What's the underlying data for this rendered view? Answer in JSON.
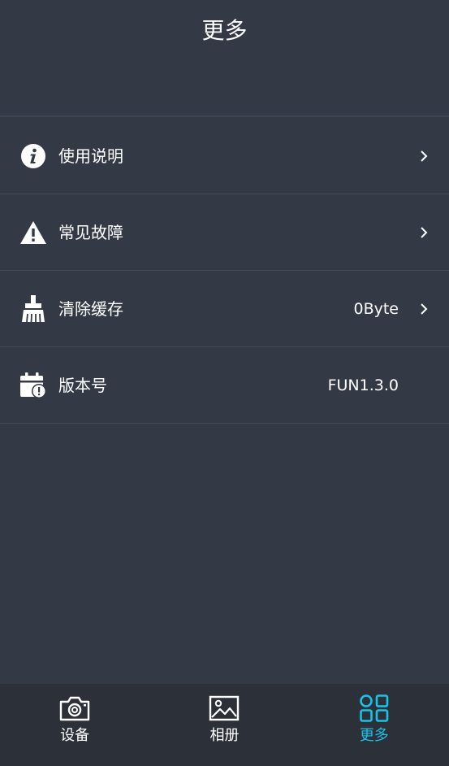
{
  "header": {
    "title": "更多"
  },
  "menu": {
    "items": [
      {
        "label": "使用说明",
        "value": "",
        "icon": "info-icon",
        "has_chevron": true
      },
      {
        "label": "常见故障",
        "value": "",
        "icon": "warning-icon",
        "has_chevron": true
      },
      {
        "label": "清除缓存",
        "value": "0Byte",
        "icon": "broom-icon",
        "has_chevron": true
      },
      {
        "label": "版本号",
        "value": "FUN1.3.0",
        "icon": "calendar-alert-icon",
        "has_chevron": false
      }
    ]
  },
  "tabbar": {
    "tabs": [
      {
        "label": "设备",
        "icon": "camera-icon",
        "active": false
      },
      {
        "label": "相册",
        "icon": "image-icon",
        "active": false
      },
      {
        "label": "更多",
        "icon": "grid-icon",
        "active": true
      }
    ]
  },
  "colors": {
    "background": "#333a46",
    "tabbar_background": "#2b3039",
    "accent": "#19c2e6",
    "text": "#ffffff"
  }
}
